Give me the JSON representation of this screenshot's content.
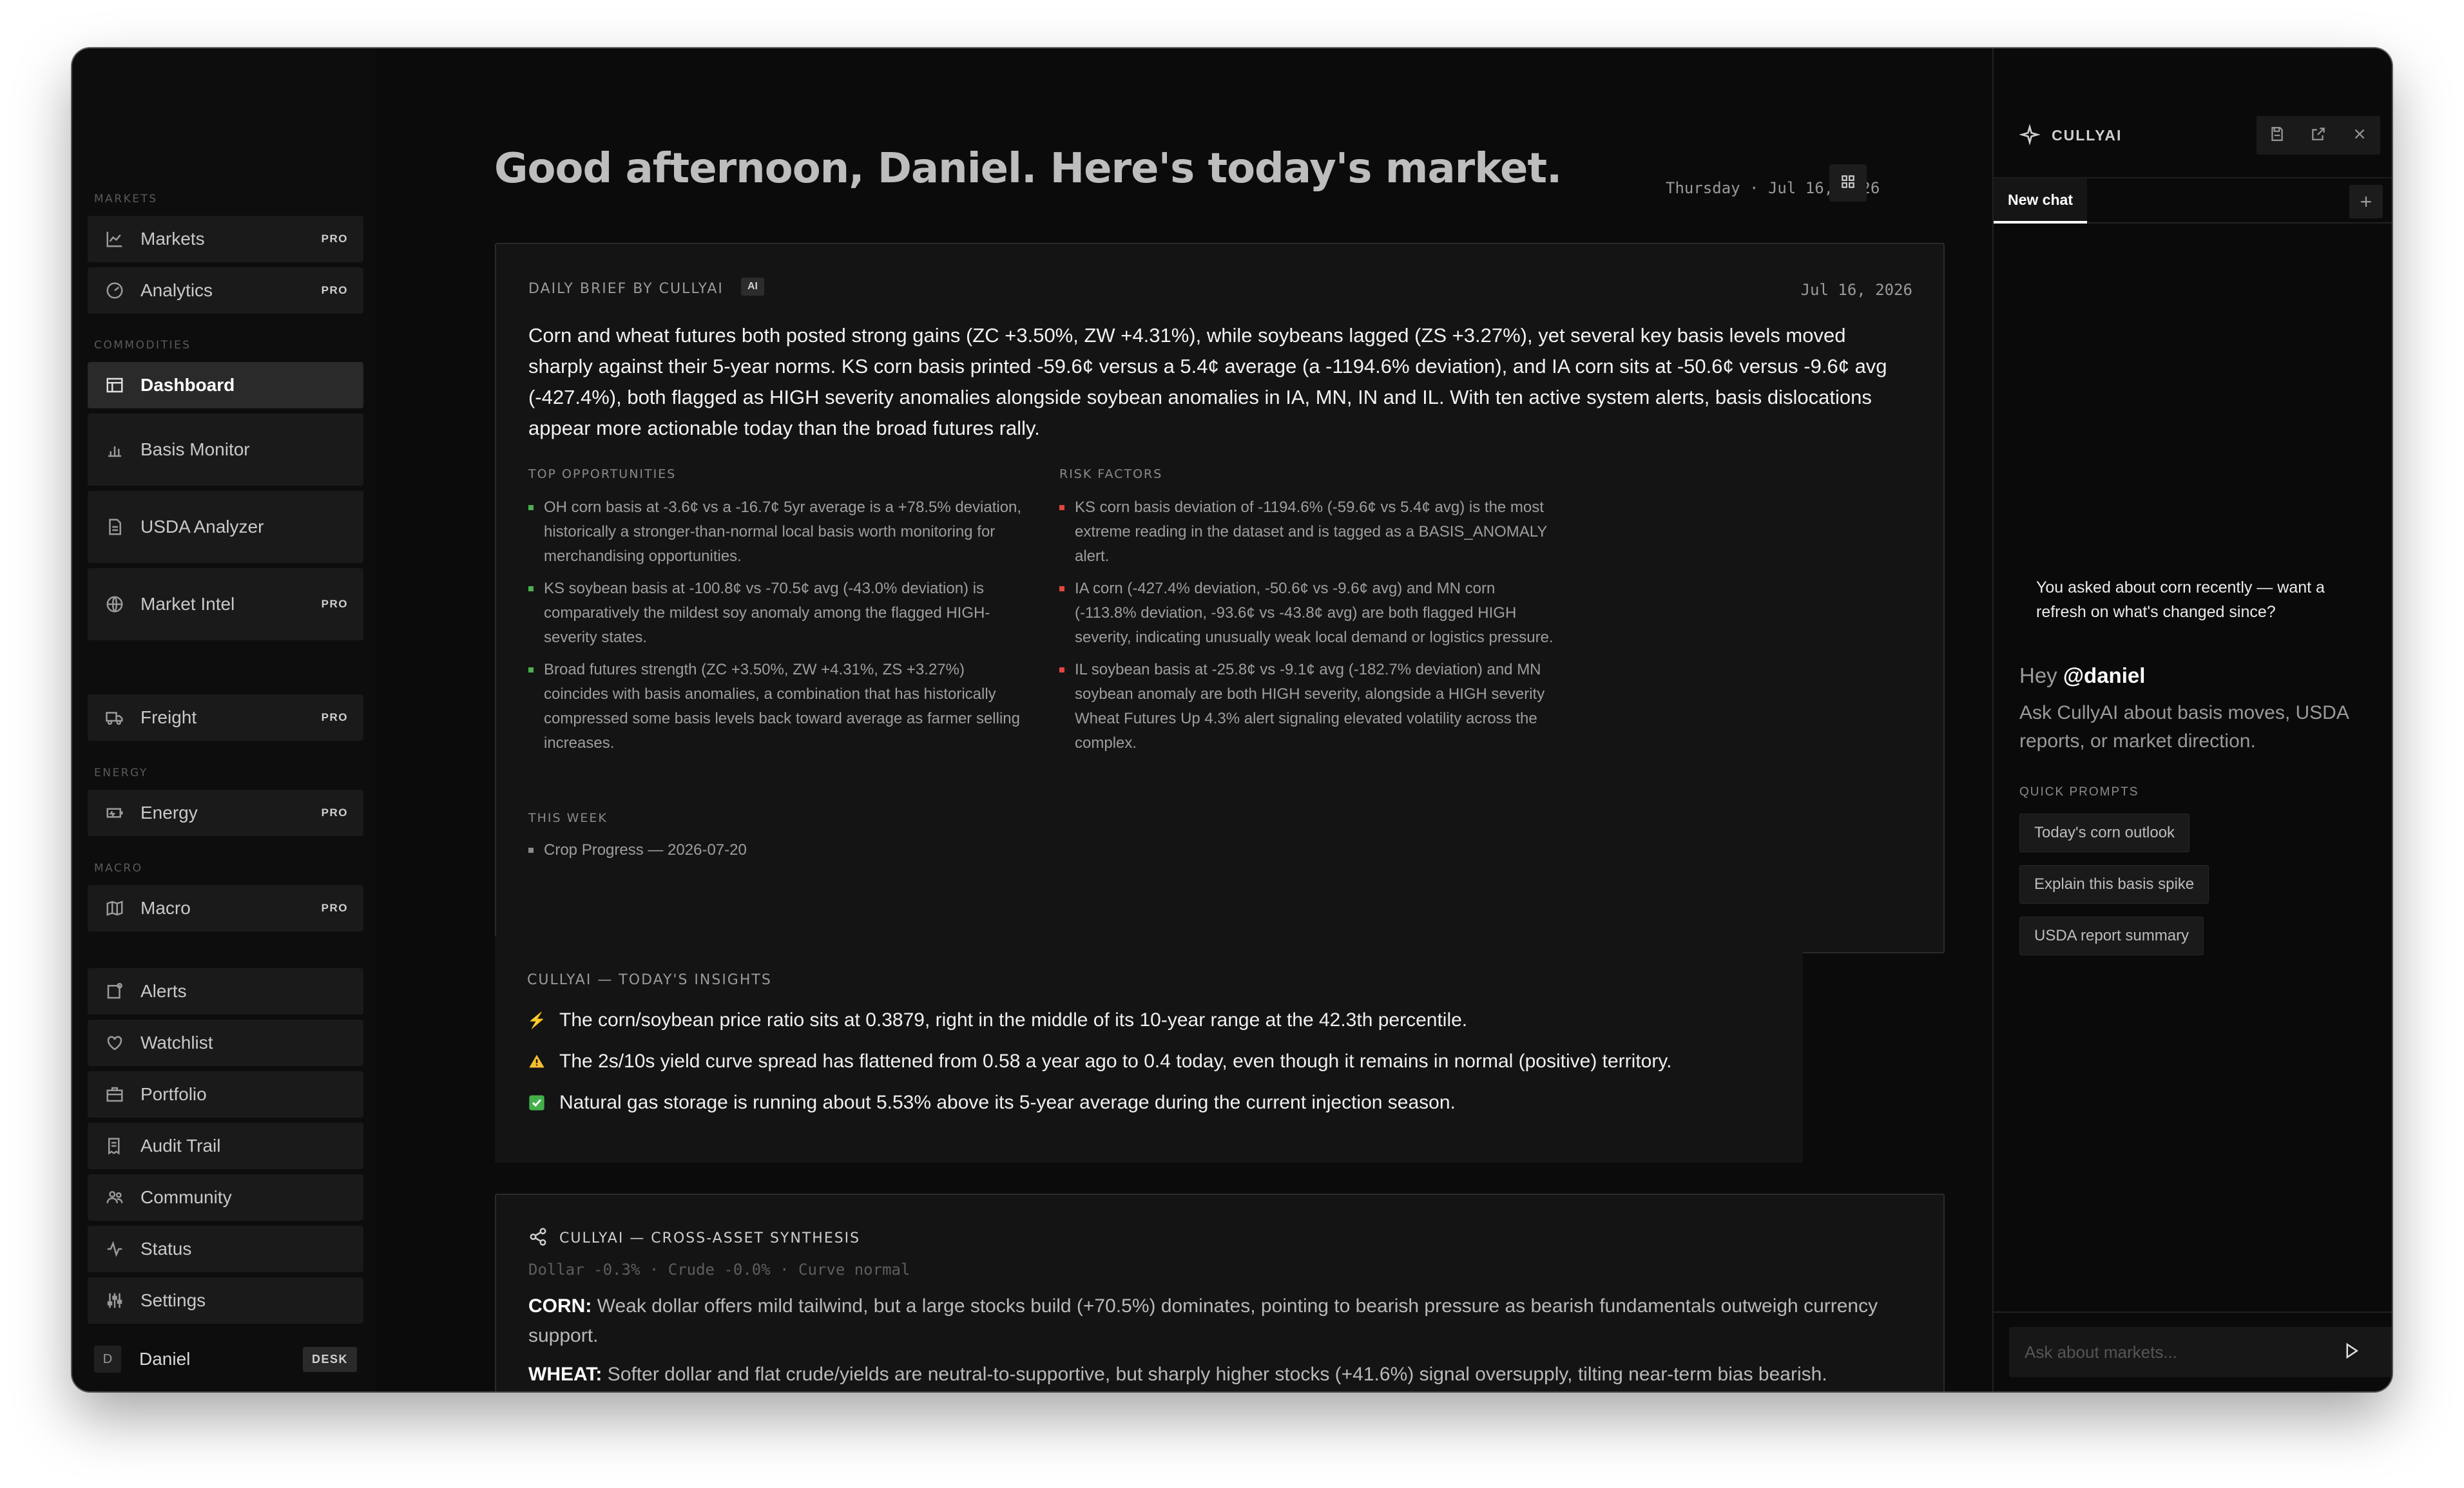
{
  "window": {
    "colors": {
      "close": "#e0463f",
      "minimize": "#f0c030",
      "maximize": "#4caf50"
    }
  },
  "sidebar": {
    "sections": {
      "markets": "MARKETS",
      "commodities": "COMMODITIES",
      "energy": "ENERGY",
      "macro": "MACRO"
    },
    "items": [
      {
        "label": "Markets",
        "badge": "PRO",
        "icon": "chart-line-icon"
      },
      {
        "label": "Analytics",
        "badge": "PRO",
        "icon": "gauge-icon"
      },
      {
        "label": "Dashboard",
        "badge": "",
        "icon": "layout-icon"
      },
      {
        "label": "Basis Monitor",
        "badge": "",
        "icon": "bar-chart-icon"
      },
      {
        "label": "USDA Analyzer",
        "badge": "",
        "icon": "document-icon"
      },
      {
        "label": "Market Intel",
        "badge": "PRO",
        "icon": "globe-icon"
      },
      {
        "label": "Freight",
        "badge": "PRO",
        "icon": "truck-icon"
      },
      {
        "label": "Energy",
        "badge": "PRO",
        "icon": "battery-icon"
      },
      {
        "label": "Macro",
        "badge": "PRO",
        "icon": "map-icon"
      },
      {
        "label": "Alerts",
        "badge": "",
        "icon": "bell-icon"
      },
      {
        "label": "Watchlist",
        "badge": "",
        "icon": "heart-icon"
      },
      {
        "label": "Portfolio",
        "badge": "",
        "icon": "briefcase-icon"
      },
      {
        "label": "Audit Trail",
        "badge": "",
        "icon": "receipt-icon"
      },
      {
        "label": "Community",
        "badge": "",
        "icon": "users-icon"
      },
      {
        "label": "Status",
        "badge": "",
        "icon": "activity-icon"
      },
      {
        "label": "Settings",
        "badge": "",
        "icon": "sliders-icon"
      }
    ],
    "user": {
      "initial": "D",
      "name": "Daniel",
      "tag": "DESK"
    }
  },
  "main": {
    "greeting": "Good afternoon, Daniel. Here's today's market.",
    "date": "Thursday · Jul 16, 2026",
    "brief": {
      "label": "DAILY BRIEF BY CULLYAI",
      "ai_badge": "AI",
      "date": "Jul 16, 2026",
      "text": "Corn and wheat futures both posted strong gains (ZC +3.50%, ZW +4.31%), while soybeans lagged (ZS +3.27%), yet several key basis levels moved sharply against their 5-year norms. KS corn basis printed -59.6¢ versus a 5.4¢ average (a -1194.6% deviation), and IA corn sits at -50.6¢ versus -9.6¢ avg (-427.4%), both flagged as HIGH severity anomalies alongside soybean anomalies in IA, MN, IN and IL. With ten active system alerts, basis dislocations appear more actionable today than the broad futures rally.",
      "opportunities_label": "TOP OPPORTUNITIES",
      "opportunities": [
        "OH corn basis at -3.6¢ vs a -16.7¢ 5yr average is a +78.5% deviation, historically a stronger-than-normal local basis worth monitoring for merchandising opportunities.",
        "KS soybean basis at -100.8¢ vs -70.5¢ avg (-43.0% deviation) is comparatively the mildest soy anomaly among the flagged HIGH-severity states.",
        "Broad futures strength (ZC +3.50%, ZW +4.31%, ZS +3.27%) coincides with basis anomalies, a combination that has historically compressed some basis levels back toward average as farmer selling increases."
      ],
      "risks_label": "RISK FACTORS",
      "risks": [
        "KS corn basis deviation of -1194.6% (-59.6¢ vs 5.4¢ avg) is the most extreme reading in the dataset and is tagged as a BASIS_ANOMALY alert.",
        "IA corn (-427.4% deviation, -50.6¢ vs -9.6¢ avg) and MN corn (-113.8% deviation, -93.6¢ vs -43.8¢ avg) are both flagged HIGH severity, indicating unusually weak local demand or logistics pressure.",
        "IL soybean basis at -25.8¢ vs -9.1¢ avg (-182.7% deviation) and MN soybean anomaly are both HIGH severity, alongside a HIGH severity Wheat Futures Up 4.3% alert signaling elevated volatility across the complex."
      ],
      "week_label": "THIS WEEK",
      "week": [
        "Crop Progress — 2026-07-20"
      ]
    },
    "insights": {
      "label": "CULLYAI — TODAY'S INSIGHTS",
      "items": [
        {
          "icon": "lightning-icon",
          "text": "The corn/soybean price ratio sits at 0.3879, right in the middle of its 10-year range at the 42.3th percentile."
        },
        {
          "icon": "warning-icon",
          "text": "The 2s/10s yield curve spread has flattened from 0.58 a year ago to 0.4 today, even though it remains in normal (positive) territory."
        },
        {
          "icon": "check-icon",
          "text": "Natural gas storage is running about 5.53% above its 5-year average during the current injection season."
        }
      ]
    },
    "synthesis": {
      "label": "CULLYAI — CROSS-ASSET SYNTHESIS",
      "meta": "Dollar -0.3% · Crude -0.0% · Curve normal",
      "items": [
        {
          "commodity": "CORN:",
          "text": "Weak dollar offers mild tailwind, but a large stocks build (+70.5%) dominates, pointing to bearish pressure as bearish fundamentals outweigh currency support."
        },
        {
          "commodity": "WHEAT:",
          "text": "Softer dollar and flat crude/yields are neutral-to-supportive, but sharply higher stocks (+41.6%) signal oversupply, tilting near-term bias bearish."
        }
      ]
    }
  },
  "panel": {
    "title": "CULLYAI",
    "tab": "New chat",
    "nudge": "You asked about corn recently — want a refresh on what's changed since?",
    "hey": "Hey",
    "handle": "@daniel",
    "ask": "Ask CullyAI about basis moves, USDA reports, or market direction.",
    "quick_label": "QUICK PROMPTS",
    "prompts": [
      "Today's corn outlook",
      "Explain this basis spike",
      "USDA report summary"
    ],
    "placeholder": "Ask about markets..."
  }
}
